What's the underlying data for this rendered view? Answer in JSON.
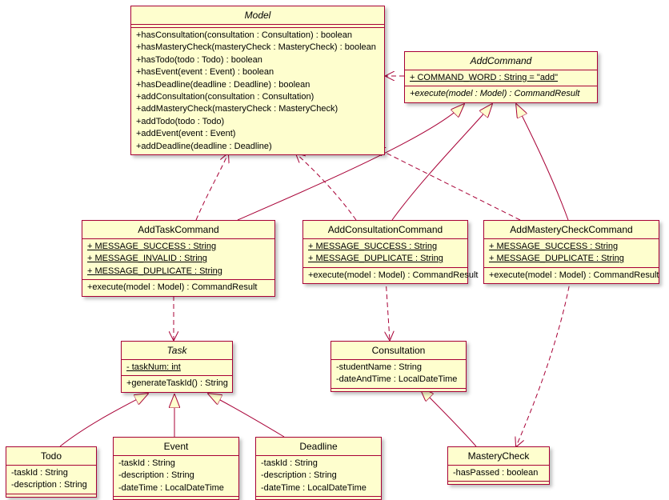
{
  "chart_data": {
    "type": "uml_class_diagram",
    "classes": [
      {
        "name": "Model",
        "abstract": true,
        "attributes": [],
        "methods": [
          "+hasConsultation(consultation : Consultation) : boolean",
          "+hasMasteryCheck(masteryCheck : MasteryCheck) : boolean",
          "+hasTodo(todo : Todo) : boolean",
          "+hasEvent(event : Event) : boolean",
          "+hasDeadline(deadline : Deadline) : boolean",
          "+addConsultation(consultation : Consultation)",
          "+addMasteryCheck(masteryCheck : MasteryCheck)",
          "+addTodo(todo : Todo)",
          "+addEvent(event : Event)",
          "+addDeadline(deadline : Deadline)"
        ]
      },
      {
        "name": "AddCommand",
        "abstract": true,
        "attributes": [
          "+ COMMAND_WORD : String = \"add\""
        ],
        "methods": [
          "+execute(model : Model) : CommandResult"
        ]
      },
      {
        "name": "AddTaskCommand",
        "attributes": [
          "+ MESSAGE_SUCCESS : String",
          "+ MESSAGE_INVALID : String",
          "+ MESSAGE_DUPLICATE : String"
        ],
        "methods": [
          "+execute(model : Model) : CommandResult"
        ]
      },
      {
        "name": "AddConsultationCommand",
        "attributes": [
          "+ MESSAGE_SUCCESS : String",
          "+ MESSAGE_DUPLICATE : String"
        ],
        "methods": [
          "+execute(model : Model) : CommandResult"
        ]
      },
      {
        "name": "AddMasteryCheckCommand",
        "attributes": [
          "+ MESSAGE_SUCCESS : String",
          "+ MESSAGE_DUPLICATE : String"
        ],
        "methods": [
          "+execute(model : Model) : CommandResult"
        ]
      },
      {
        "name": "Task",
        "abstract": true,
        "attributes": [
          "- taskNum: int"
        ],
        "methods": [
          "+generateTaskId() : String"
        ]
      },
      {
        "name": "Consultation",
        "attributes": [
          "-studentName : String",
          "-dateAndTime : LocalDateTime"
        ],
        "methods": []
      },
      {
        "name": "Todo",
        "attributes": [
          "-taskId : String",
          "-description : String"
        ],
        "methods": []
      },
      {
        "name": "Event",
        "attributes": [
          "-taskId : String",
          "-description : String",
          "-dateTime : LocalDateTime"
        ],
        "methods": []
      },
      {
        "name": "Deadline",
        "attributes": [
          "-taskId : String",
          "-description : String",
          "-dateTime : LocalDateTime"
        ],
        "methods": []
      },
      {
        "name": "MasteryCheck",
        "attributes": [
          "-hasPassed : boolean"
        ],
        "methods": []
      }
    ],
    "relationships": [
      {
        "from": "AddCommand",
        "to": "Model",
        "type": "dependency_arrow"
      },
      {
        "from": "AddTaskCommand",
        "to": "AddCommand",
        "type": "inheritance"
      },
      {
        "from": "AddConsultationCommand",
        "to": "AddCommand",
        "type": "inheritance"
      },
      {
        "from": "AddMasteryCheckCommand",
        "to": "AddCommand",
        "type": "inheritance"
      },
      {
        "from": "AddTaskCommand",
        "to": "Model",
        "type": "dependency"
      },
      {
        "from": "AddConsultationCommand",
        "to": "Model",
        "type": "dependency"
      },
      {
        "from": "AddMasteryCheckCommand",
        "to": "Model",
        "type": "dependency"
      },
      {
        "from": "AddTaskCommand",
        "to": "Task",
        "type": "dependency"
      },
      {
        "from": "AddConsultationCommand",
        "to": "Consultation",
        "type": "dependency"
      },
      {
        "from": "AddMasteryCheckCommand",
        "to": "MasteryCheck",
        "type": "dependency"
      },
      {
        "from": "Todo",
        "to": "Task",
        "type": "inheritance"
      },
      {
        "from": "Event",
        "to": "Task",
        "type": "inheritance"
      },
      {
        "from": "Deadline",
        "to": "Task",
        "type": "inheritance"
      },
      {
        "from": "MasteryCheck",
        "to": "Consultation",
        "type": "inheritance"
      }
    ]
  },
  "model": {
    "title": "Model",
    "m0": "+hasConsultation(consultation : Consultation) : boolean",
    "m1": "+hasMasteryCheck(masteryCheck : MasteryCheck) : boolean",
    "m2": "+hasTodo(todo : Todo) : boolean",
    "m3": "+hasEvent(event : Event) : boolean",
    "m4": "+hasDeadline(deadline : Deadline) : boolean",
    "m5": "+addConsultation(consultation : Consultation)",
    "m6": "+addMasteryCheck(masteryCheck : MasteryCheck)",
    "m7": "+addTodo(todo : Todo)",
    "m8": "+addEvent(event : Event)",
    "m9": "+addDeadline(deadline : Deadline)"
  },
  "addCommand": {
    "title": "AddCommand",
    "a0": "+ COMMAND_WORD : String = \"add\"",
    "m0": "+execute(model : Model) : CommandResult"
  },
  "addTask": {
    "title": "AddTaskCommand",
    "a0": "+ MESSAGE_SUCCESS : String",
    "a1": "+ MESSAGE_INVALID : String",
    "a2": "+ MESSAGE_DUPLICATE : String",
    "m0": "+execute(model : Model) : CommandResult"
  },
  "addConsult": {
    "title": "AddConsultationCommand",
    "a0": "+ MESSAGE_SUCCESS : String",
    "a1": "+ MESSAGE_DUPLICATE : String",
    "m0": "+execute(model : Model) : CommandResult"
  },
  "addMastery": {
    "title": "AddMasteryCheckCommand",
    "a0": "+ MESSAGE_SUCCESS : String",
    "a1": "+ MESSAGE_DUPLICATE : String",
    "m0": "+execute(model : Model) : CommandResult"
  },
  "task": {
    "title": "Task",
    "a0": "- taskNum: int",
    "m0": "+generateTaskId() : String"
  },
  "consultation": {
    "title": "Consultation",
    "a0": "-studentName : String",
    "a1": "-dateAndTime : LocalDateTime"
  },
  "todo": {
    "title": "Todo",
    "a0": "-taskId : String",
    "a1": "-description : String"
  },
  "event": {
    "title": "Event",
    "a0": "-taskId : String",
    "a1": "-description : String",
    "a2": "-dateTime : LocalDateTime"
  },
  "deadline": {
    "title": "Deadline",
    "a0": "-taskId : String",
    "a1": "-description : String",
    "a2": "-dateTime : LocalDateTime"
  },
  "masteryCheck": {
    "title": "MasteryCheck",
    "a0": "-hasPassed : boolean"
  }
}
